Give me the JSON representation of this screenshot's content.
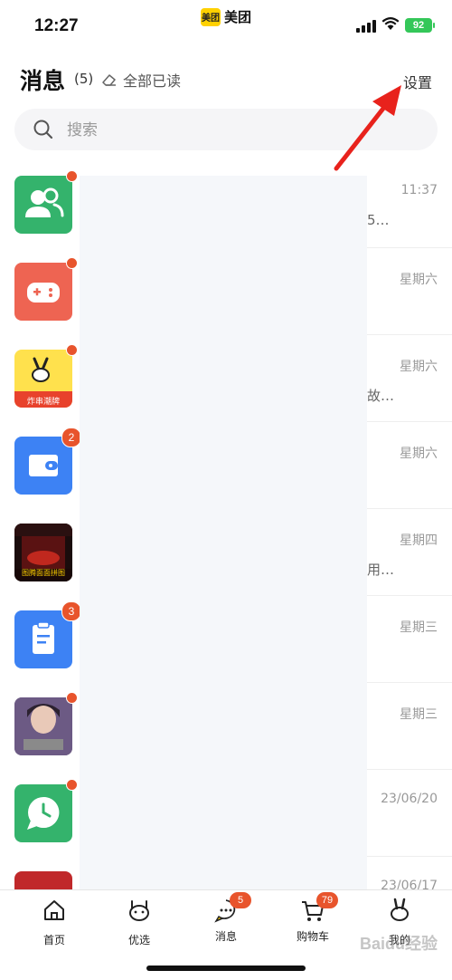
{
  "status": {
    "time": "12:27",
    "app_badge": "美团",
    "app_name": "美团",
    "battery": "92"
  },
  "header": {
    "title": "消息",
    "count": "(5)",
    "mark_all_read": "全部已读",
    "settings": "设置",
    "search_placeholder": "搜索"
  },
  "messages": [
    {
      "time": "11:37",
      "snippet": "5…",
      "dot": true
    },
    {
      "time": "星期六",
      "snippet": "",
      "dot": true
    },
    {
      "time": "星期六",
      "snippet": "故…",
      "dot": true,
      "avatar_text": "炸串潮牌"
    },
    {
      "time": "星期六",
      "snippet": "",
      "badge": "2"
    },
    {
      "time": "星期四",
      "snippet": "用…",
      "dot": false,
      "avatar_text": "图腾面面拼图"
    },
    {
      "time": "星期三",
      "snippet": "",
      "badge": "3"
    },
    {
      "time": "星期三",
      "snippet": "",
      "dot": true
    },
    {
      "time": "23/06/20",
      "snippet": "",
      "dot": true
    },
    {
      "time": "23/06/17",
      "snippet": "",
      "dot": false
    }
  ],
  "tabs": [
    {
      "label": "首页"
    },
    {
      "label": "优选"
    },
    {
      "label": "消息",
      "badge": "5"
    },
    {
      "label": "购物车",
      "badge": "79"
    },
    {
      "label": "我的"
    }
  ],
  "watermark": "Baidu经验",
  "colors": {
    "accent": "#e8542c",
    "green": "#34b36c",
    "blue": "#3d82f4",
    "red_icon": "#ee6452",
    "arrow": "#e8221c"
  }
}
